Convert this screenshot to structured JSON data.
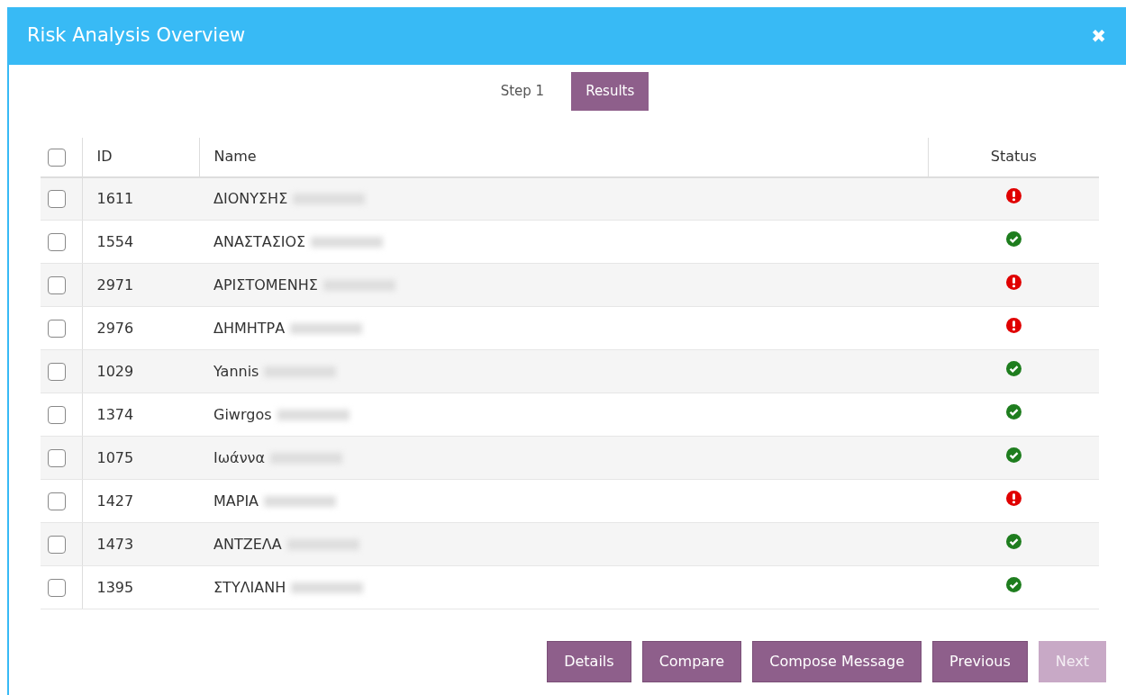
{
  "window": {
    "title": "Risk Analysis Overview",
    "close": "✖"
  },
  "tabs": [
    {
      "label": "Step 1",
      "selected": false
    },
    {
      "label": "Results",
      "selected": true
    }
  ],
  "table": {
    "columns": [
      "ID",
      "Name",
      "Status"
    ],
    "all_checked": false,
    "rows": [
      {
        "id": "1611",
        "name": "ΔΙΟΝΥΣΗΣ",
        "checked": false,
        "kind": "error"
      },
      {
        "id": "1554",
        "name": "ΑΝΑΣΤΑΣΙΟΣ",
        "checked": false,
        "kind": "ok"
      },
      {
        "id": "2971",
        "name": "ΑΡΙΣΤΟΜΕΝΗΣ",
        "checked": false,
        "kind": "error"
      },
      {
        "id": "2976",
        "name": "ΔΗΜΗΤΡΑ",
        "checked": false,
        "kind": "error"
      },
      {
        "id": "1029",
        "name": "Yannis",
        "checked": false,
        "kind": "ok"
      },
      {
        "id": "1374",
        "name": "Giwrgos",
        "checked": false,
        "kind": "ok"
      },
      {
        "id": "1075",
        "name": "Ιωάννα",
        "checked": false,
        "kind": "ok"
      },
      {
        "id": "1427",
        "name": "ΜΑΡΙΑ",
        "checked": false,
        "kind": "error"
      },
      {
        "id": "1473",
        "name": "ΑΝΤΖΕΛΑ",
        "checked": false,
        "kind": "ok"
      },
      {
        "id": "1395",
        "name": "ΣΤΥΛΙΑΝΗ",
        "checked": false,
        "kind": "ok"
      }
    ]
  },
  "buttons": [
    {
      "label": "Details",
      "disabled": false
    },
    {
      "label": "Compare",
      "disabled": false
    },
    {
      "label": "Compose Message",
      "disabled": false
    },
    {
      "label": "Previous",
      "disabled": false
    },
    {
      "label": "Next",
      "disabled": true
    }
  ]
}
